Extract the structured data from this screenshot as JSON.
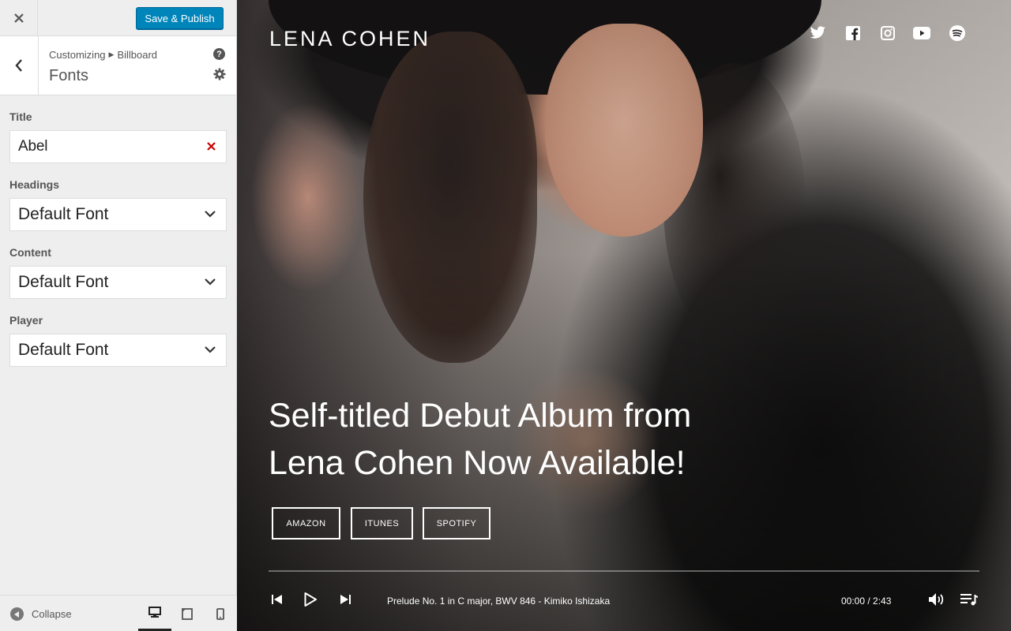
{
  "topbar": {
    "close_icon": "close-icon",
    "publish_label": "Save & Publish",
    "publish_color": "#0085ba"
  },
  "section": {
    "breadcrumb_root": "Customizing",
    "breadcrumb_parent": "Billboard",
    "title": "Fonts"
  },
  "controls": [
    {
      "label": "Title",
      "value": "Abel",
      "kind": "text-with-clear"
    },
    {
      "label": "Headings",
      "value": "Default Font",
      "kind": "select"
    },
    {
      "label": "Content",
      "value": "Default Font",
      "kind": "select"
    },
    {
      "label": "Player",
      "value": "Default Font",
      "kind": "select"
    }
  ],
  "footer": {
    "collapse_label": "Collapse",
    "devices": [
      "desktop-icon",
      "tablet-icon",
      "mobile-icon"
    ],
    "active_device": "desktop-icon"
  },
  "preview": {
    "site_title": "LENA COHEN",
    "social_icons": [
      "twitter-icon",
      "facebook-icon",
      "instagram-icon",
      "youtube-icon",
      "spotify-icon"
    ],
    "headline_line1": "Self-titled Debut Album from",
    "headline_line2": "Lena Cohen Now Available!",
    "buttons": [
      "AMAZON",
      "ITUNES",
      "SPOTIFY"
    ],
    "player": {
      "track": "Prelude No. 1 in C major, BWV 846 - Kimiko Ishizaka",
      "time": "00:00 / 2:43",
      "progress_percent": 0
    }
  }
}
